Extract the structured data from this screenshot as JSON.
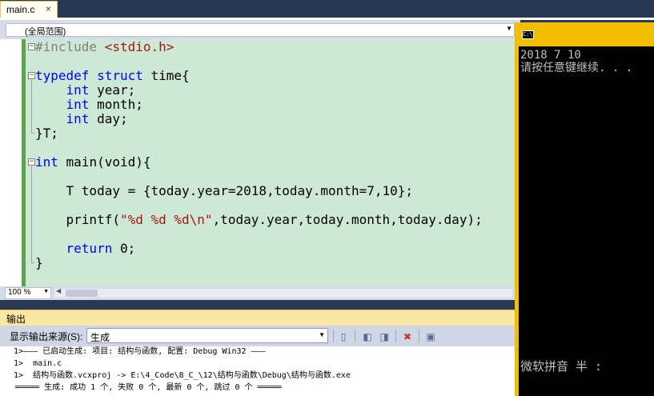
{
  "window": {
    "tab_label": "main.c",
    "tab_close": "×",
    "scope_label": "(全局范围)"
  },
  "editor": {
    "lines": [
      {
        "pre": "",
        "kw": "",
        "pp": "#include ",
        "str": "<stdio.h>",
        "rest": ""
      },
      {
        "pre": "",
        "kw": "",
        "pp": "",
        "str": "",
        "rest": ""
      },
      {
        "pre": "",
        "kw": "typedef struct",
        "pp": "",
        "str": "",
        "rest": " time{"
      },
      {
        "pre": "    ",
        "kw": "int",
        "pp": "",
        "str": "",
        "rest": " year;"
      },
      {
        "pre": "    ",
        "kw": "int",
        "pp": "",
        "str": "",
        "rest": " month;"
      },
      {
        "pre": "    ",
        "kw": "int",
        "pp": "",
        "str": "",
        "rest": " day;"
      },
      {
        "pre": "",
        "kw": "",
        "pp": "",
        "str": "",
        "rest": "}T;"
      },
      {
        "pre": "",
        "kw": "",
        "pp": "",
        "str": "",
        "rest": ""
      },
      {
        "pre": "",
        "kw": "int",
        "pp": "",
        "str": "",
        "rest": " main(void){"
      },
      {
        "pre": "",
        "kw": "",
        "pp": "",
        "str": "",
        "rest": ""
      },
      {
        "pre": "    ",
        "kw": "",
        "pp": "",
        "str": "",
        "rest": "T today = {today.year=2018,today.month=7,10};"
      },
      {
        "pre": "",
        "kw": "",
        "pp": "",
        "str": "",
        "rest": ""
      },
      {
        "pre": "    ",
        "kw": "",
        "pp": "",
        "str": "",
        "rest": "printf(\"%d %d %d\\n\",today.year,today.month,today.day);"
      },
      {
        "pre": "",
        "kw": "",
        "pp": "",
        "str": "",
        "rest": ""
      },
      {
        "pre": "    ",
        "kw": "return",
        "pp": "",
        "str": "",
        "rest": " 0;"
      },
      {
        "pre": "",
        "kw": "",
        "pp": "",
        "str": "",
        "rest": "}"
      }
    ],
    "printf_head": "    printf(",
    "printf_str": "\"%d %d %d\\n\"",
    "printf_tail": ",today.year,today.month,today.day);",
    "zoom": "100 %"
  },
  "output": {
    "title": "输出",
    "source_label": "显示输出来源(S):",
    "source_value": "生成",
    "lines": [
      "1>——— 已启动生成: 项目: 结构与函数, 配置: Debug Win32 ———",
      "1>  main.c",
      "1>  结构与函数.vcxproj -> E:\\4_Code\\8_C_\\12\\结构与函数\\Debug\\结构与函数.exe",
      "═════ 生成: 成功 1 个, 失败 0 个, 最新 0 个, 跳过 0 个 ═════"
    ]
  },
  "console": {
    "icon_text": "C:\\",
    "lines": [
      "2018 7 10",
      "请按任意键继续. . ."
    ],
    "ime": "微软拼音 半 :"
  },
  "colors": {
    "keyword": "#0000ff",
    "string": "#a31515",
    "editor_bg": "#cde8d5",
    "console_border": "#f2bf00"
  }
}
